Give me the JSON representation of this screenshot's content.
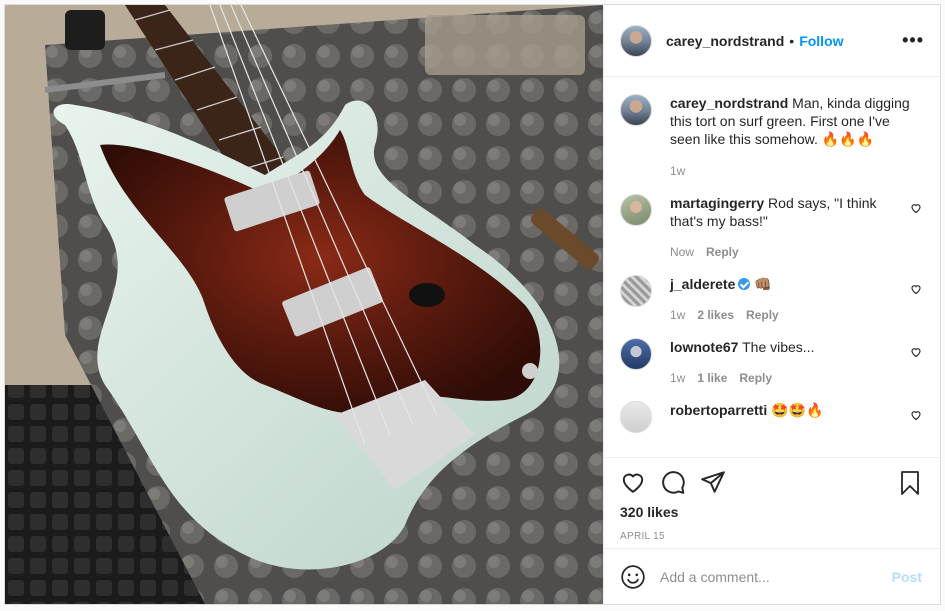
{
  "post": {
    "username": "carey_nordstrand",
    "separator": "•",
    "follow_label": "Follow",
    "more_label": "•••",
    "caption": {
      "username": "carey_nordstrand",
      "text": "Man, kinda digging this tort on surf green. First one I've seen like this somehow. 🔥🔥🔥",
      "time": "1w"
    },
    "comments": [
      {
        "username": "martagingerry",
        "text": "Rod says, \"I think that's my bass!\"",
        "time": "Now",
        "likes": "",
        "reply_label": "Reply"
      },
      {
        "username": "j_alderete",
        "text": "👊🏽",
        "verified": true,
        "time": "1w",
        "likes": "2 likes",
        "reply_label": "Reply"
      },
      {
        "username": "lownote67",
        "text": "The vibes...",
        "time": "1w",
        "likes": "1 like",
        "reply_label": "Reply"
      },
      {
        "username": "robertoparretti",
        "text": "🤩🤩🔥",
        "time": "",
        "likes": "",
        "reply_label": ""
      }
    ],
    "likes_count": "320 likes",
    "date": "APRIL 15",
    "add_comment_placeholder": "Add a comment...",
    "post_button": "Post"
  },
  "icons": {
    "like": "heart-icon",
    "comment": "comment-icon",
    "share": "share-icon",
    "save": "bookmark-icon",
    "emoji": "emoji-icon",
    "more": "more-icon"
  },
  "colors": {
    "accent": "#0095f6",
    "post_button_disabled": "#b2dffc",
    "muted": "#8e8e8e",
    "text": "#262626"
  }
}
